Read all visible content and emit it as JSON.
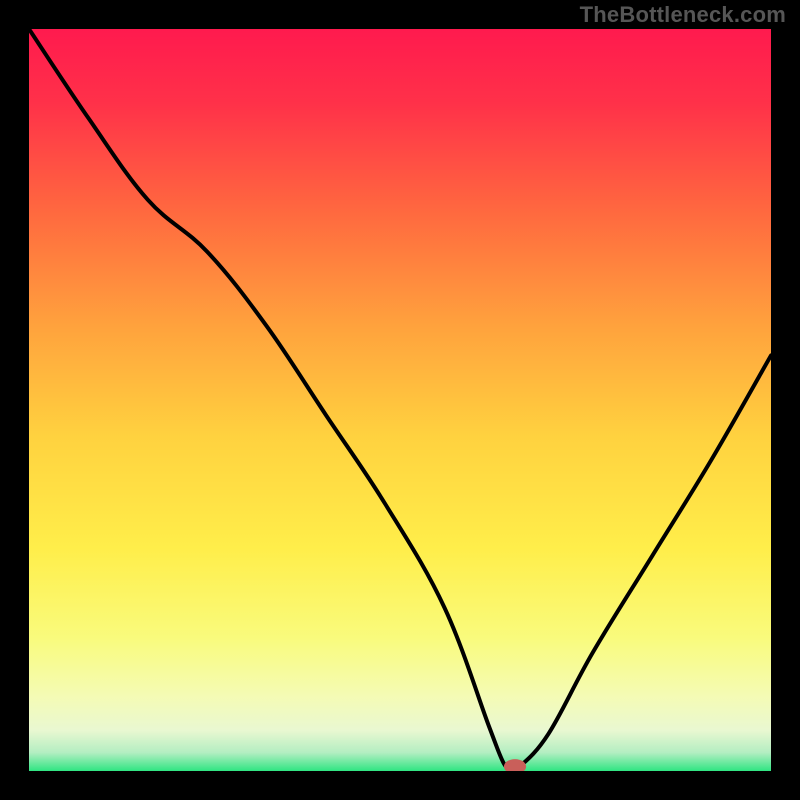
{
  "watermark": "TheBottleneck.com",
  "chart_data": {
    "type": "line",
    "title": "",
    "xlabel": "",
    "ylabel": "",
    "xlim": [
      0,
      100
    ],
    "ylim": [
      0,
      100
    ],
    "series": [
      {
        "name": "curve",
        "x": [
          0,
          8,
          16,
          24,
          32,
          40,
          48,
          56,
          62,
          64,
          65,
          66,
          70,
          76,
          84,
          92,
          100
        ],
        "y": [
          100,
          88,
          77,
          70,
          60,
          48,
          36,
          22,
          6,
          1,
          0.5,
          0.5,
          5,
          16,
          29,
          42,
          56
        ]
      }
    ],
    "marker": {
      "x": 65.5,
      "y": 0.6,
      "color": "#c95f5a"
    },
    "gradient_stops": [
      {
        "offset": 0,
        "color": "#ff1a4e"
      },
      {
        "offset": 0.1,
        "color": "#ff3149"
      },
      {
        "offset": 0.25,
        "color": "#ff6a3f"
      },
      {
        "offset": 0.4,
        "color": "#ffa23d"
      },
      {
        "offset": 0.55,
        "color": "#ffd23f"
      },
      {
        "offset": 0.7,
        "color": "#ffee4a"
      },
      {
        "offset": 0.82,
        "color": "#f9fb7c"
      },
      {
        "offset": 0.9,
        "color": "#f4fbb5"
      },
      {
        "offset": 0.945,
        "color": "#e9f8d1"
      },
      {
        "offset": 0.975,
        "color": "#b4eec2"
      },
      {
        "offset": 1.0,
        "color": "#2fe582"
      }
    ]
  }
}
